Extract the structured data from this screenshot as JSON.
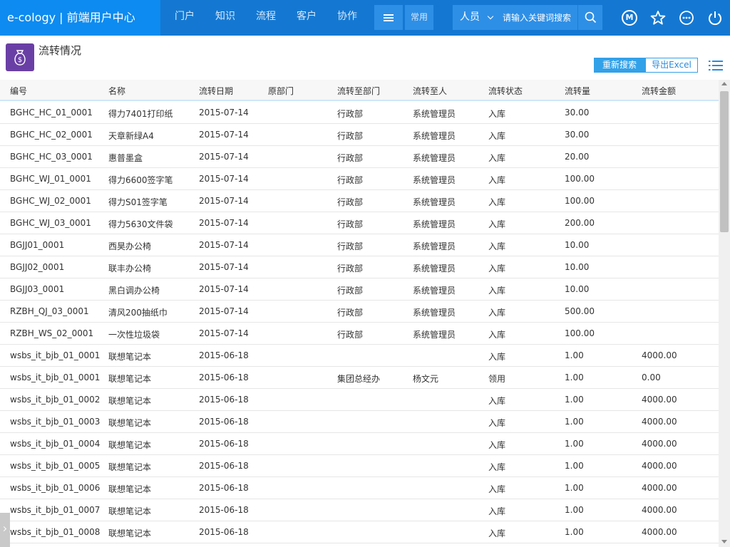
{
  "header": {
    "brand": "e-cology | 前端用户中心",
    "nav": [
      "门户",
      "知识",
      "流程",
      "客户",
      "协作"
    ],
    "common_label": "常用",
    "search": {
      "type_label": "人员",
      "placeholder": "请输入关键词搜索"
    },
    "avatar_letter": "M"
  },
  "page": {
    "title": "流转情况",
    "btn_research": "重新搜索",
    "btn_export": "导出Excel"
  },
  "table": {
    "columns": [
      "编号",
      "名称",
      "流转日期",
      "原部门",
      "流转至部门",
      "流转至人",
      "流转状态",
      "流转量",
      "流转金额"
    ],
    "rows": [
      [
        "BGHC_HC_01_0001",
        "得力7401打印纸",
        "2015-07-14",
        "",
        "行政部",
        "系统管理员",
        "入库",
        "30.00",
        ""
      ],
      [
        "BGHC_HC_02_0001",
        "天章新绿A4",
        "2015-07-14",
        "",
        "行政部",
        "系统管理员",
        "入库",
        "30.00",
        ""
      ],
      [
        "BGHC_HC_03_0001",
        "惠普墨盒",
        "2015-07-14",
        "",
        "行政部",
        "系统管理员",
        "入库",
        "20.00",
        ""
      ],
      [
        "BGHC_WJ_01_0001",
        "得力6600签字笔",
        "2015-07-14",
        "",
        "行政部",
        "系统管理员",
        "入库",
        "100.00",
        ""
      ],
      [
        "BGHC_WJ_02_0001",
        "得力S01签字笔",
        "2015-07-14",
        "",
        "行政部",
        "系统管理员",
        "入库",
        "100.00",
        ""
      ],
      [
        "BGHC_WJ_03_0001",
        "得力5630文件袋",
        "2015-07-14",
        "",
        "行政部",
        "系统管理员",
        "入库",
        "200.00",
        ""
      ],
      [
        "BGJJ01_0001",
        "西昊办公椅",
        "2015-07-14",
        "",
        "行政部",
        "系统管理员",
        "入库",
        "10.00",
        ""
      ],
      [
        "BGJJ02_0001",
        "联丰办公椅",
        "2015-07-14",
        "",
        "行政部",
        "系统管理员",
        "入库",
        "10.00",
        ""
      ],
      [
        "BGJJ03_0001",
        "黑白调办公椅",
        "2015-07-14",
        "",
        "行政部",
        "系统管理员",
        "入库",
        "10.00",
        ""
      ],
      [
        "RZBH_QJ_03_0001",
        "清风200抽纸巾",
        "2015-07-14",
        "",
        "行政部",
        "系统管理员",
        "入库",
        "500.00",
        ""
      ],
      [
        "RZBH_WS_02_0001",
        "一次性垃圾袋",
        "2015-07-14",
        "",
        "行政部",
        "系统管理员",
        "入库",
        "100.00",
        ""
      ],
      [
        "wsbs_it_bjb_01_0001",
        "联想笔记本",
        "2015-06-18",
        "",
        "",
        "",
        "入库",
        "1.00",
        "4000.00"
      ],
      [
        "wsbs_it_bjb_01_0001",
        "联想笔记本",
        "2015-06-18",
        "",
        "集团总经办",
        "杨文元",
        "领用",
        "1.00",
        "0.00"
      ],
      [
        "wsbs_it_bjb_01_0002",
        "联想笔记本",
        "2015-06-18",
        "",
        "",
        "",
        "入库",
        "1.00",
        "4000.00"
      ],
      [
        "wsbs_it_bjb_01_0003",
        "联想笔记本",
        "2015-06-18",
        "",
        "",
        "",
        "入库",
        "1.00",
        "4000.00"
      ],
      [
        "wsbs_it_bjb_01_0004",
        "联想笔记本",
        "2015-06-18",
        "",
        "",
        "",
        "入库",
        "1.00",
        "4000.00"
      ],
      [
        "wsbs_it_bjb_01_0005",
        "联想笔记本",
        "2015-06-18",
        "",
        "",
        "",
        "入库",
        "1.00",
        "4000.00"
      ],
      [
        "wsbs_it_bjb_01_0006",
        "联想笔记本",
        "2015-06-18",
        "",
        "",
        "",
        "入库",
        "1.00",
        "4000.00"
      ],
      [
        "wsbs_it_bjb_01_0007",
        "联想笔记本",
        "2015-06-18",
        "",
        "",
        "",
        "入库",
        "1.00",
        "4000.00"
      ],
      [
        "wsbs_it_bjb_01_0008",
        "联想笔记本",
        "2015-06-18",
        "",
        "",
        "",
        "入库",
        "1.00",
        "4000.00"
      ]
    ]
  }
}
